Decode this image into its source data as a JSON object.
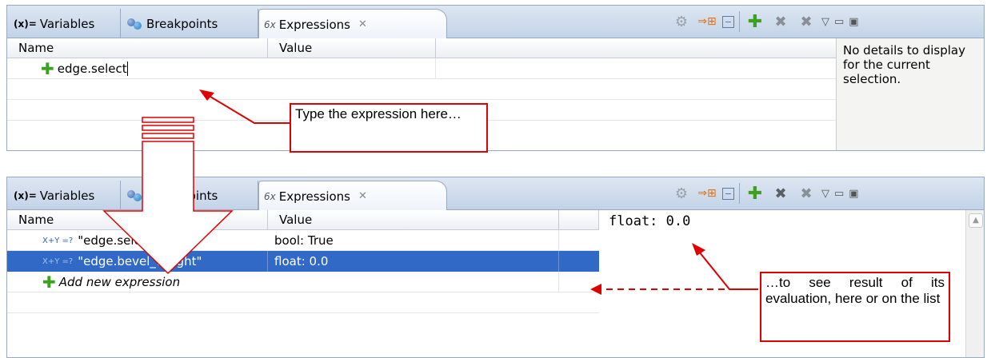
{
  "tabs": {
    "variables": "Variables",
    "breakpoints": "Breakpoints",
    "expressions": "Expressions",
    "variables_icon": "(x)=",
    "expressions_icon": "6x"
  },
  "columns": {
    "name": "Name",
    "value": "Value"
  },
  "top": {
    "edit_value": "edge.select",
    "details": "No details to display for the current selection."
  },
  "bottom": {
    "rows": [
      {
        "name": "\"edge.select\"",
        "value": "bool: True"
      },
      {
        "name": "\"edge.bevel_weight\"",
        "value": "float: 0.0"
      }
    ],
    "add_new": "Add new expression",
    "details": "float: 0.0",
    "xy_icon": "X+Y =?"
  },
  "callouts": {
    "type_here": "Type the expression here…",
    "see_result": "…to see result of its evaluation, here or on the list"
  },
  "colors": {
    "selection": "#3169c6",
    "annotation": "#e00000",
    "plus": "#3ca020"
  }
}
